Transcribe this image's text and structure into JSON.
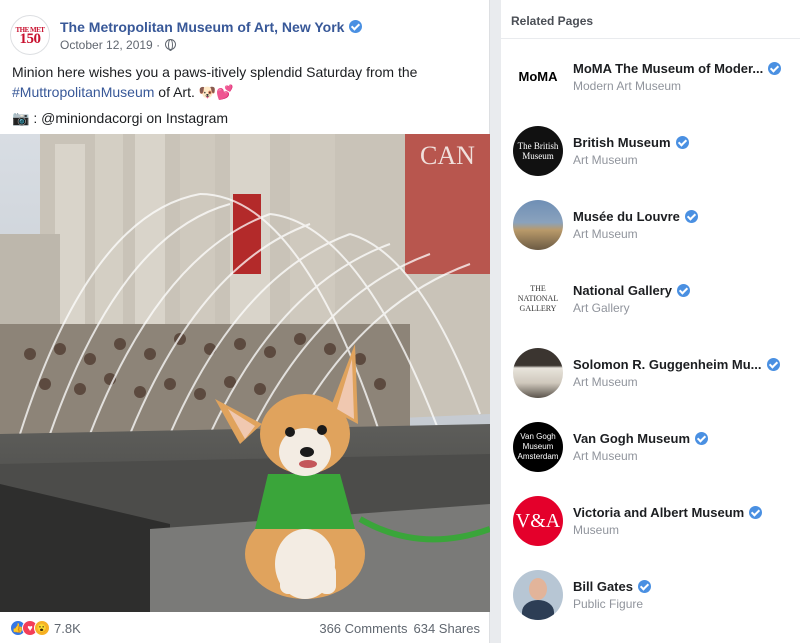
{
  "post": {
    "avatar_text_top": "THE MET",
    "avatar_text_big": "150",
    "page_name": "The Metropolitan Museum of Art, New York",
    "date": "October 12, 2019 ·",
    "text_line1": "Minion here wishes you a paws-itively splendid Saturday from the",
    "hashtag": "#MuttropolitanMuseum",
    "text_line2_rest": " of Art. 🐶💕",
    "credit": "📷 : @miniondacorgi on Instagram",
    "photo_sign": "CAN",
    "reactions_count": "7.8K",
    "comments": "366 Comments",
    "shares": "634 Shares",
    "colors": {
      "link": "#385898",
      "verified": "#4a90e2",
      "met_red": "#c8102e"
    }
  },
  "related": {
    "title": "Related Pages",
    "items": [
      {
        "name": "MoMA The Museum of Moder...",
        "category": "Modern Art Museum",
        "logo": "MoMA"
      },
      {
        "name": "British Museum",
        "category": "Art Museum",
        "logo": "The British Museum"
      },
      {
        "name": "Musée du Louvre",
        "category": "Art Museum",
        "logo": ""
      },
      {
        "name": "National Gallery",
        "category": "Art Gallery",
        "logo": "THE NATIONAL GALLERY"
      },
      {
        "name": "Solomon R. Guggenheim Mu...",
        "category": "Art Museum",
        "logo": ""
      },
      {
        "name": "Van Gogh Museum",
        "category": "Art Museum",
        "logo": "Van Gogh Museum Amsterdam"
      },
      {
        "name": "Victoria and Albert Museum",
        "category": "Museum",
        "logo": "V&A"
      },
      {
        "name": "Bill Gates",
        "category": "Public Figure",
        "logo": ""
      }
    ]
  }
}
